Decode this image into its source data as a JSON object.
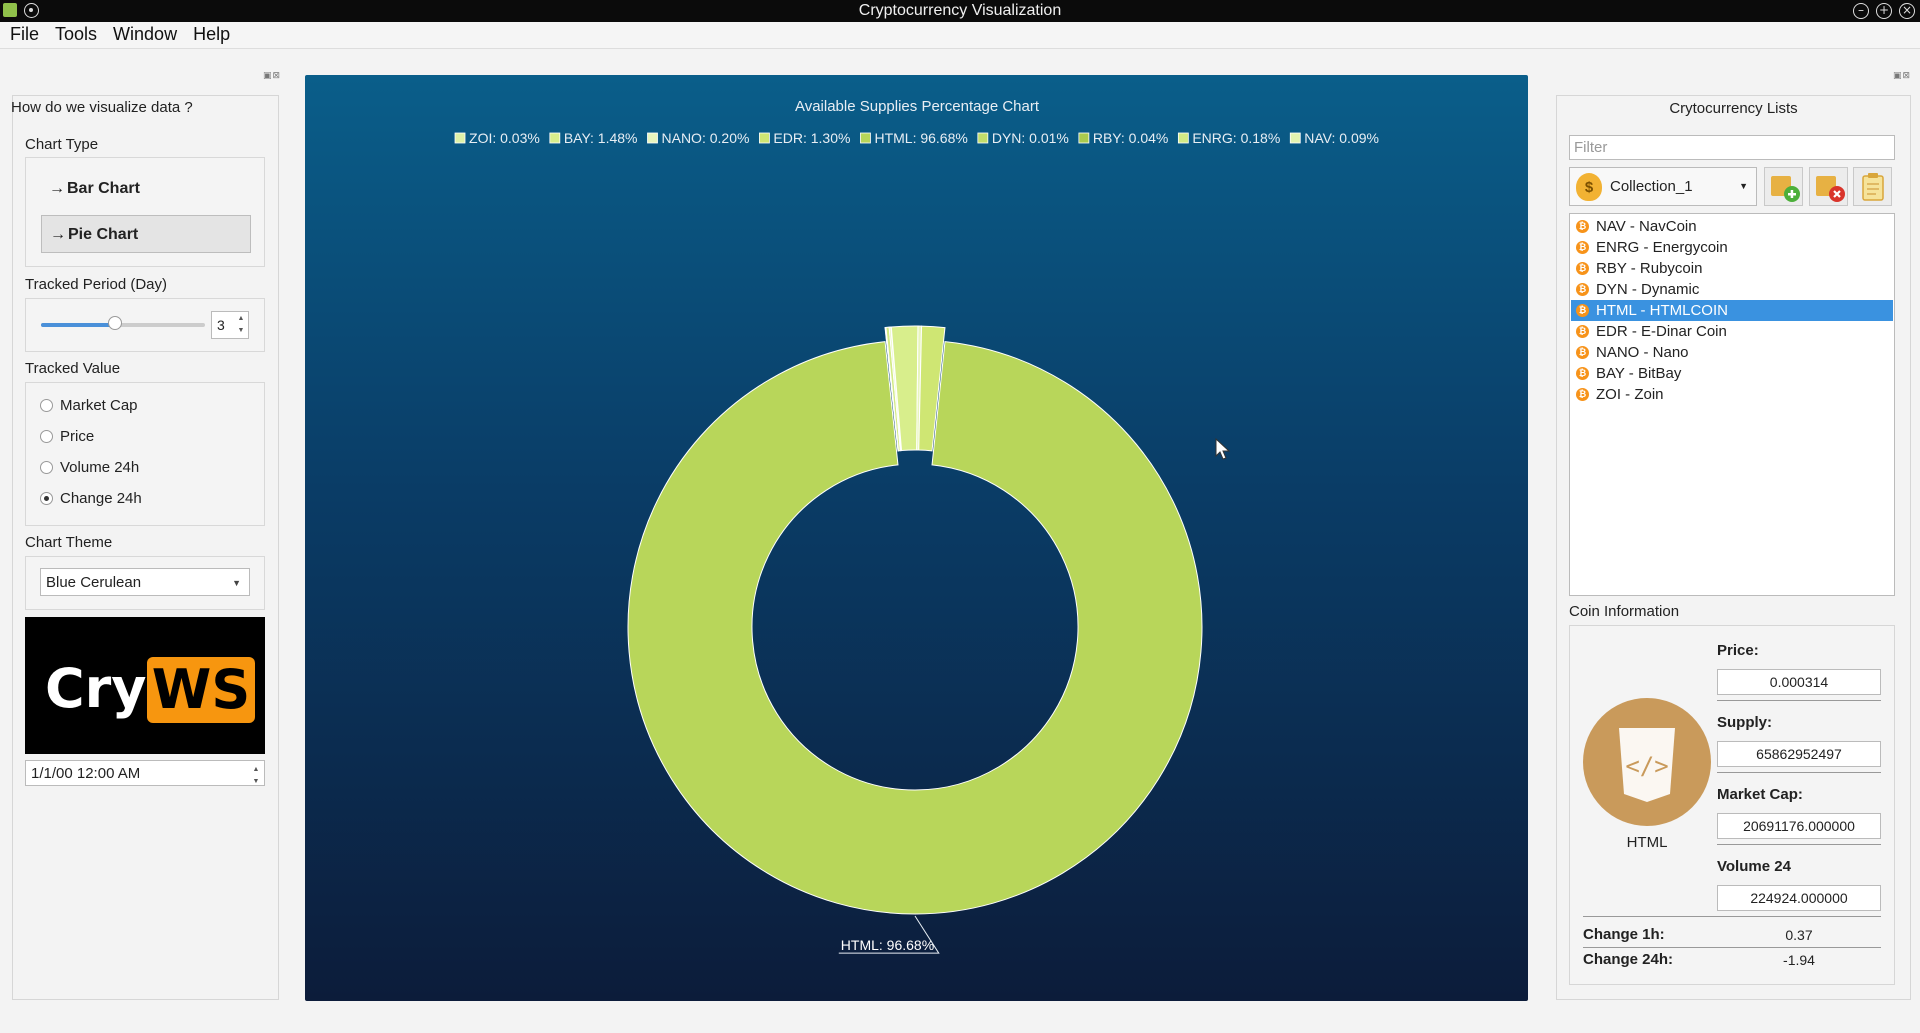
{
  "window": {
    "title": "Cryptocurrency Visualization"
  },
  "menu": {
    "file": "File",
    "tools": "Tools",
    "window": "Window",
    "help": "Help"
  },
  "left_panel": {
    "heading": "How do we visualize data ?",
    "chart_type": {
      "label": "Chart Type",
      "bar": "Bar Chart",
      "pie": "Pie Chart",
      "selected": "Pie Chart"
    },
    "tracked_period": {
      "label": "Tracked Period (Day)",
      "value": "3",
      "slider_fraction": 0.45
    },
    "tracked_value": {
      "label": "Tracked Value",
      "options": [
        "Market Cap",
        "Price",
        "Volume 24h",
        "Change 24h"
      ],
      "selected": "Change 24h"
    },
    "chart_theme": {
      "label": "Chart Theme",
      "value": "Blue Cerulean"
    },
    "logo": {
      "left": "Cry",
      "right": "WS"
    },
    "datetime": "1/1/00 12:00 AM"
  },
  "chart_data": {
    "type": "pie",
    "title": "Available Supplies Percentage Chart",
    "categories": [
      "ZOI",
      "BAY",
      "NANO",
      "EDR",
      "HTML",
      "DYN",
      "RBY",
      "ENRG",
      "NAV"
    ],
    "values": [
      0.03,
      1.48,
      0.2,
      1.3,
      96.68,
      0.01,
      0.04,
      0.18,
      0.09
    ],
    "legend": [
      "ZOI: 0.03%",
      "BAY: 1.48%",
      "NANO: 0.20%",
      "EDR: 1.30%",
      "HTML: 96.68%",
      "DYN: 0.01%",
      "RBY: 0.04%",
      "ENRG: 0.18%",
      "NAV: 0.09%"
    ],
    "legend_placement": "top",
    "donut": true,
    "exploded": "HTML",
    "slice_label": "HTML: 96.68%",
    "colors": [
      "#dff2a8",
      "#d8ee8c",
      "#e8f5bd",
      "#cfe673",
      "#b8d65a",
      "#c2dd6a",
      "#aacb4e",
      "#d2ea85",
      "#e3f3b0"
    ]
  },
  "right_panel": {
    "heading": "Crytocurrency Lists",
    "filter_placeholder": "Filter",
    "collection": "Collection_1",
    "coins": [
      "NAV - NavCoin",
      "ENRG - Energycoin",
      "RBY - Rubycoin",
      "DYN - Dynamic",
      "HTML - HTMLCOIN",
      "EDR - E-Dinar Coin",
      "NANO - Nano",
      "BAY - BitBay",
      "ZOI - Zoin"
    ],
    "selected_coin": "HTML - HTMLCOIN",
    "coin_info": {
      "label": "Coin Information",
      "symbol": "HTML",
      "price_label": "Price:",
      "price": "0.000314",
      "supply_label": "Supply:",
      "supply": "65862952497",
      "marketcap_label": "Market Cap:",
      "marketcap": "20691176.000000",
      "volume_label": "Volume 24",
      "volume": "224924.000000",
      "change1h_label": "Change 1h:",
      "change1h": "0.37",
      "change24h_label": "Change 24h:",
      "change24h": "-1.94"
    }
  },
  "colors": {
    "accent": "#3a92e0",
    "coin": "#c99a5b",
    "bitcoin": "#f7931a"
  }
}
